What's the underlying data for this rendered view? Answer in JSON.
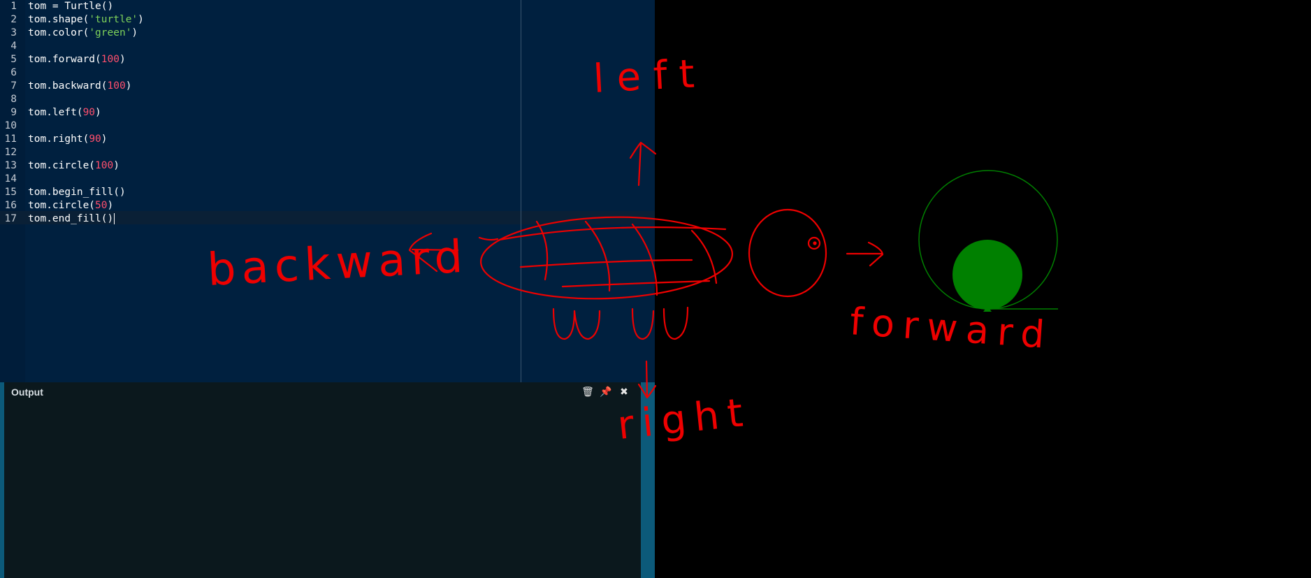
{
  "editor": {
    "lines": [
      {
        "n": "1",
        "parts": [
          {
            "t": "tom = Turtle()"
          }
        ]
      },
      {
        "n": "2",
        "parts": [
          {
            "t": "tom.shape("
          },
          {
            "t": "'turtle'",
            "c": "str"
          },
          {
            "t": ")"
          }
        ]
      },
      {
        "n": "3",
        "parts": [
          {
            "t": "tom.color("
          },
          {
            "t": "'green'",
            "c": "str"
          },
          {
            "t": ")"
          }
        ]
      },
      {
        "n": "4",
        "parts": []
      },
      {
        "n": "5",
        "parts": [
          {
            "t": "tom.forward("
          },
          {
            "t": "100",
            "c": "num"
          },
          {
            "t": ")"
          }
        ]
      },
      {
        "n": "6",
        "parts": []
      },
      {
        "n": "7",
        "parts": [
          {
            "t": "tom.backward("
          },
          {
            "t": "100",
            "c": "num"
          },
          {
            "t": ")"
          }
        ]
      },
      {
        "n": "8",
        "parts": []
      },
      {
        "n": "9",
        "parts": [
          {
            "t": "tom.left("
          },
          {
            "t": "90",
            "c": "num"
          },
          {
            "t": ")"
          }
        ]
      },
      {
        "n": "10",
        "parts": []
      },
      {
        "n": "11",
        "parts": [
          {
            "t": "tom.right("
          },
          {
            "t": "90",
            "c": "num"
          },
          {
            "t": ")"
          }
        ]
      },
      {
        "n": "12",
        "parts": []
      },
      {
        "n": "13",
        "parts": [
          {
            "t": "tom.circle("
          },
          {
            "t": "100",
            "c": "num"
          },
          {
            "t": ")"
          }
        ]
      },
      {
        "n": "14",
        "parts": []
      },
      {
        "n": "15",
        "parts": [
          {
            "t": "tom.begin_fill()"
          }
        ]
      },
      {
        "n": "16",
        "parts": [
          {
            "t": "tom.circle("
          },
          {
            "t": "50",
            "c": "num"
          },
          {
            "t": ")"
          }
        ]
      },
      {
        "n": "17",
        "parts": [
          {
            "t": "tom.end_fill()"
          }
        ],
        "cursor": true
      }
    ]
  },
  "output": {
    "title": "Output",
    "buttons": [
      {
        "name": "clear-output-icon",
        "glyph": "🗑"
      },
      {
        "name": "pin-icon",
        "glyph": "📌"
      },
      {
        "name": "close-icon",
        "glyph": "✖"
      }
    ]
  },
  "annotations": {
    "backward": "backward",
    "forward": "forward",
    "left": "left",
    "right": "right"
  },
  "colors": {
    "editor_bg": "#00203f",
    "output_bg": "#0b181d",
    "accent_bar": "#0c5a7a",
    "ink": "#ee0000",
    "turtle_green": "#008000"
  }
}
